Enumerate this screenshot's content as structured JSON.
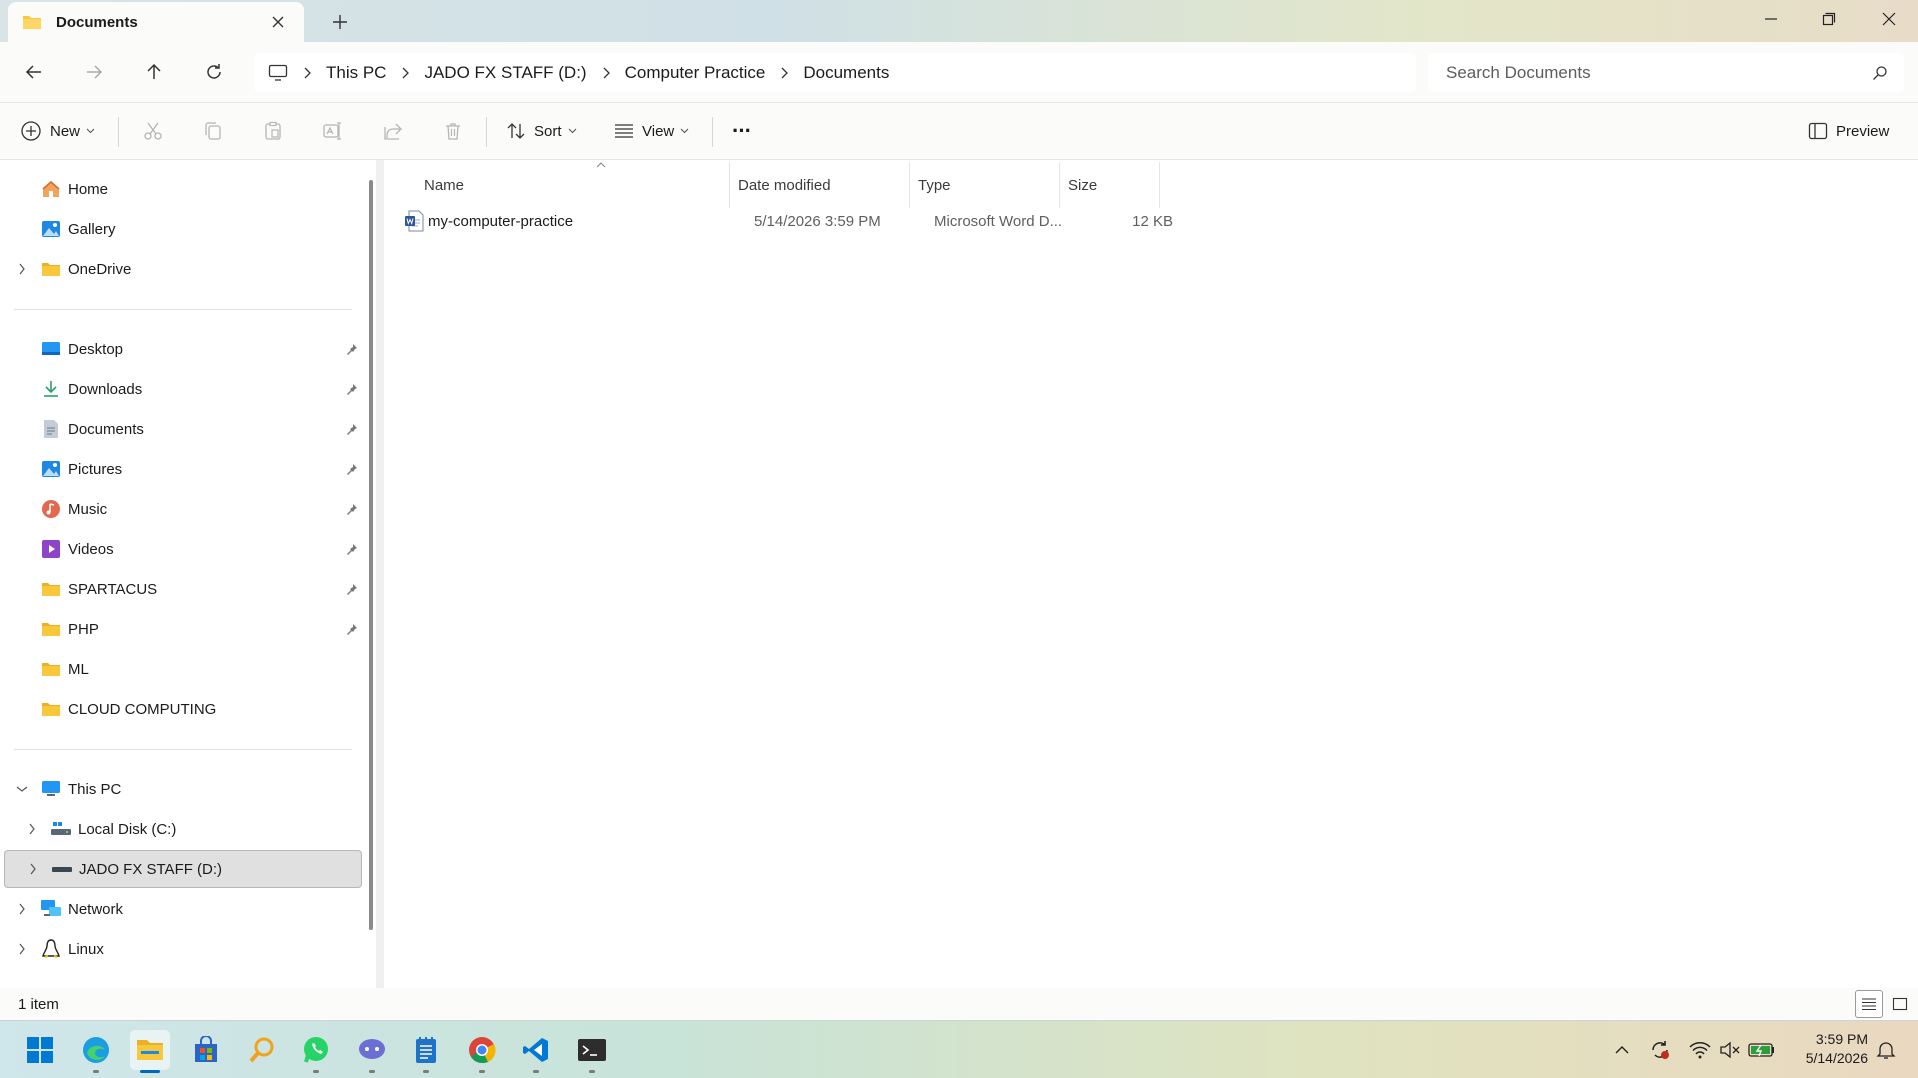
{
  "window": {
    "tab_title": "Documents"
  },
  "address": {
    "crumbs": [
      "This PC",
      "JADO FX STAFF (D:)",
      "Computer Practice",
      "Documents"
    ]
  },
  "search": {
    "placeholder": "Search Documents"
  },
  "commandbar": {
    "new_label": "New",
    "sort_label": "Sort",
    "view_label": "View",
    "more_label": "···",
    "preview_label": "Preview"
  },
  "sidebar": {
    "top": [
      "Home",
      "Gallery",
      "OneDrive"
    ],
    "quick": [
      "Desktop",
      "Downloads",
      "Documents",
      "Pictures",
      "Music",
      "Videos",
      "SPARTACUS",
      "PHP",
      "ML",
      "CLOUD COMPUTING"
    ],
    "pc": [
      "This PC",
      "Local Disk (C:)",
      "JADO FX STAFF (D:)",
      "Network",
      "Linux"
    ]
  },
  "columns": {
    "name": "Name",
    "date": "Date modified",
    "type": "Type",
    "size": "Size"
  },
  "files": [
    {
      "name": "my-computer-practice",
      "date": "5/14/2026 3:59 PM",
      "type": "Microsoft Word D...",
      "size": "12 KB"
    }
  ],
  "status": {
    "count": "1 item"
  },
  "clock": {
    "time": "3:59 PM",
    "date": "5/14/2026"
  },
  "colors": {
    "folder": "#f8c73a",
    "accent": "#0067c0",
    "word": "#2b579a"
  }
}
